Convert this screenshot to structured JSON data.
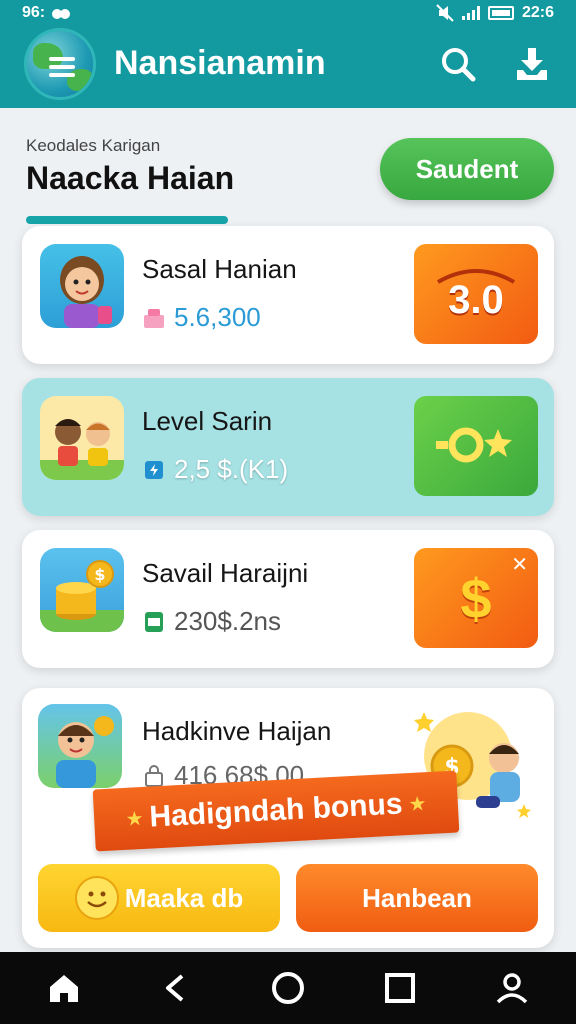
{
  "status_bar": {
    "left_text": "96:",
    "time": "22:6"
  },
  "app_bar": {
    "title": "Nansianamin",
    "icons": [
      "menu-icon",
      "search-icon",
      "download-icon"
    ]
  },
  "header": {
    "kicker": "Keodales Karigan",
    "headline": "Naacka Haian",
    "action_button": "Saudent"
  },
  "cards": [
    {
      "title": "Sasal Hanian",
      "value": "5.6,300",
      "badge": "3.0",
      "value_color": "#2b9bd6",
      "tile_color": "orange"
    },
    {
      "title": "Level Sarin",
      "value": "2,5 $.(K1)",
      "badge": "",
      "value_color": "#ffffff",
      "tile_color": "green"
    },
    {
      "title": "Savail Haraijni",
      "value": "230$.2ns",
      "badge": "$",
      "value_color": "#555555",
      "tile_color": "orange"
    },
    {
      "title": "Hadkinve Haijan",
      "value": "416 68$.00"
    }
  ],
  "bonus_banner": {
    "text": "Hadigndah bonus"
  },
  "buttons": {
    "left": "Maaka db",
    "right": "Hanbean"
  },
  "nav_bar": {
    "icons": [
      "home-icon",
      "back-icon",
      "circle-home-icon",
      "square-recents-icon",
      "profile-icon"
    ]
  }
}
